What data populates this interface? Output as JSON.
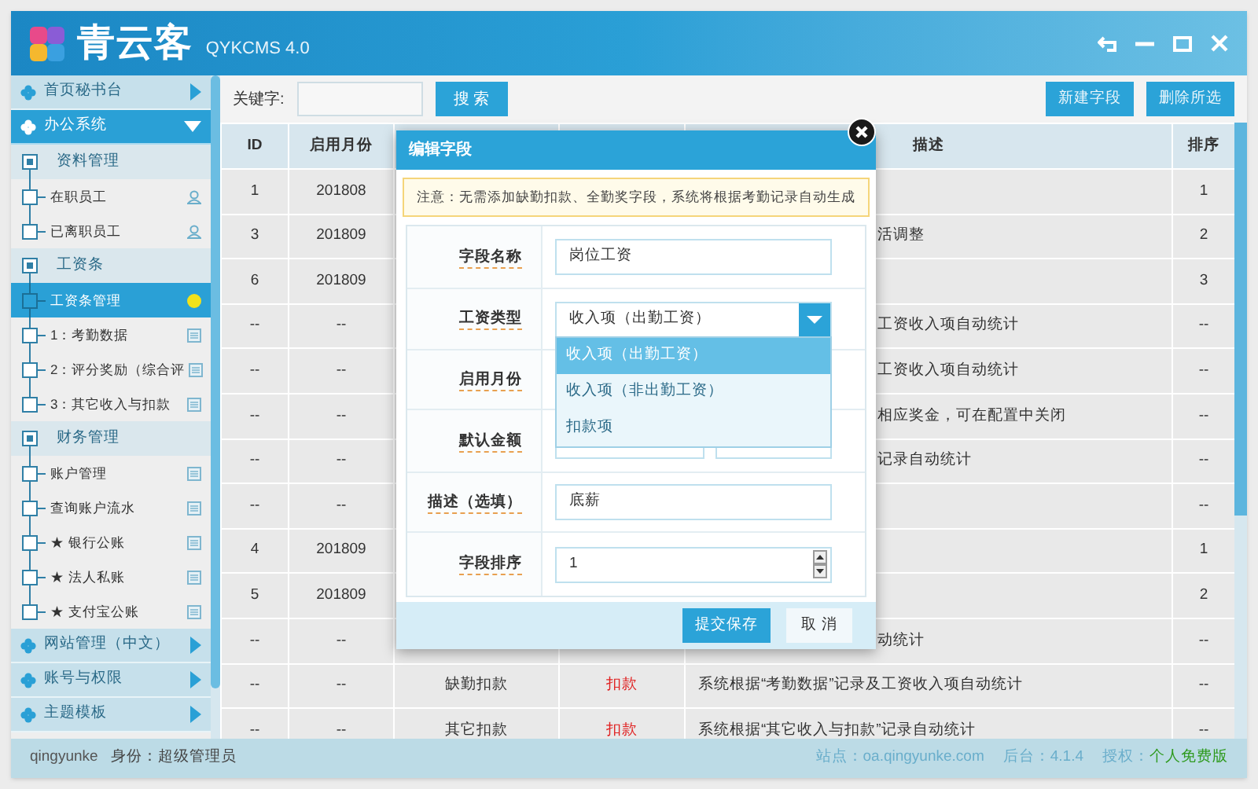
{
  "window": {
    "logo_text": "青云客",
    "version": "QYKCMS 4.0"
  },
  "sidebar": [
    {
      "label": "首页秘书台",
      "expanded": false
    },
    {
      "label": "办公系统",
      "expanded": true,
      "children": [
        {
          "label": "资料管理",
          "children": [
            {
              "label": "在职员工",
              "kind": "user",
              "selected": false
            },
            {
              "label": "已离职员工",
              "kind": "user",
              "selected": false
            }
          ]
        },
        {
          "label": "工资条",
          "children": [
            {
              "label": "工资条管理",
              "kind": "dot",
              "selected": true
            },
            {
              "label": "1：考勤数据",
              "kind": "doc",
              "selected": false
            },
            {
              "label": "2：评分奖励（综合评",
              "kind": "doc",
              "selected": false
            },
            {
              "label": "3：其它收入与扣款",
              "kind": "doc",
              "selected": false
            }
          ]
        },
        {
          "label": "财务管理",
          "children": [
            {
              "label": "账户管理",
              "kind": "doc",
              "selected": false
            },
            {
              "label": "查询账户流水",
              "kind": "doc",
              "selected": false
            },
            {
              "label": "★ 银行公账",
              "kind": "doc",
              "selected": false
            },
            {
              "label": "★ 法人私账",
              "kind": "doc",
              "selected": false
            },
            {
              "label": "★ 支付宝公账",
              "kind": "doc",
              "selected": false
            }
          ]
        }
      ]
    },
    {
      "label": "网站管理（中文）",
      "expanded": false
    },
    {
      "label": "账号与权限",
      "expanded": false
    },
    {
      "label": "主题模板",
      "expanded": false
    }
  ],
  "toolbar": {
    "keyword_label": "关键字:",
    "search_button": "搜 索",
    "buttons": [
      "新建字段",
      "删除所选"
    ]
  },
  "table": {
    "columns": [
      "ID",
      "启用月份",
      "描述",
      "排序"
    ],
    "rows": [
      {
        "id": "1",
        "month": "201808",
        "sort": "1"
      },
      {
        "id": "3",
        "month": "201809",
        "description": "活调整",
        "sort": "2"
      },
      {
        "id": "6",
        "month": "201809",
        "sort": "3"
      },
      {
        "id": "--",
        "month": "--",
        "description": "工资收入项自动统计",
        "sort": "--"
      },
      {
        "id": "--",
        "month": "--",
        "description": "工资收入项自动统计",
        "sort": "--"
      },
      {
        "id": "--",
        "month": "--",
        "description": "相应奖金，可在配置中关闭",
        "sort": "--"
      },
      {
        "id": "--",
        "month": "--",
        "description": "记录自动统计",
        "sort": "--"
      },
      {
        "id": "--",
        "month": "--",
        "sort": "--"
      },
      {
        "id": "4",
        "month": "201809",
        "sort": "1"
      },
      {
        "id": "5",
        "month": "201809",
        "sort": "2"
      },
      {
        "id": "--",
        "month": "--",
        "description": "动统计",
        "sort": "--"
      },
      {
        "id": "--",
        "month": "--",
        "name": "缺勤扣款",
        "type": "扣款",
        "description": "系统根据“考勤数据”记录及工资收入项自动统计",
        "sort": "--"
      },
      {
        "id": "--",
        "month": "--",
        "name": "其它扣款",
        "type": "扣款",
        "description": "系统根据“其它收入与扣款”记录自动统计",
        "sort": "--"
      }
    ]
  },
  "dialog": {
    "title": "编辑字段",
    "notice": "注意：无需添加缺勤扣款、全勤奖字段，系统将根据考勤记录自动生成",
    "fields": [
      {
        "label": "字段名称",
        "kind": "text",
        "value": "岗位工资"
      },
      {
        "label": "工资类型",
        "kind": "select",
        "value": "收入项（出勤工资）",
        "expanded": true,
        "options": [
          {
            "label": "收入项（出勤工资）",
            "selected": true
          },
          {
            "label": "收入项（非出勤工资）",
            "selected": false
          },
          {
            "label": "扣款项",
            "selected": false
          }
        ]
      },
      {
        "label": "启用月份",
        "kind": "text"
      },
      {
        "label": "默认金额",
        "kind": "pair"
      },
      {
        "label": "描述（选填）",
        "kind": "text",
        "value": "底薪"
      },
      {
        "label": "字段排序",
        "kind": "number",
        "value": "1"
      }
    ],
    "buttons": [
      {
        "label": "提交保存",
        "kind": "primary"
      },
      {
        "label": "取 消",
        "kind": "secondary"
      }
    ]
  },
  "status_bar": {
    "user": "qingyunke",
    "role": "身份：超级管理员",
    "site": "站点：oa.qingyunke.com",
    "backend": "后台：4.1.4",
    "license_label": "授权：",
    "license": "个人免费版"
  }
}
